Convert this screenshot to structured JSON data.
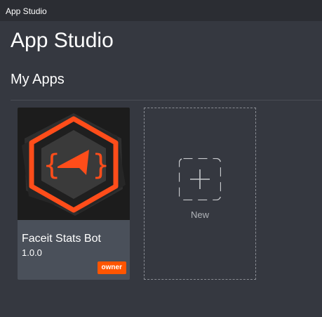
{
  "window": {
    "title": "App Studio"
  },
  "page": {
    "title": "App Studio",
    "section_title": "My Apps"
  },
  "apps": [
    {
      "name": "Faceit Stats Bot",
      "version": "1.0.0",
      "badge": "owner",
      "icon": "faceit-stats-bot-logo"
    }
  ],
  "new_app": {
    "label": "New",
    "icon": "plus-icon"
  },
  "colors": {
    "background": "#353840",
    "titlebar": "#2b2d33",
    "card": "#4a505a",
    "accent": "#ff5500"
  }
}
